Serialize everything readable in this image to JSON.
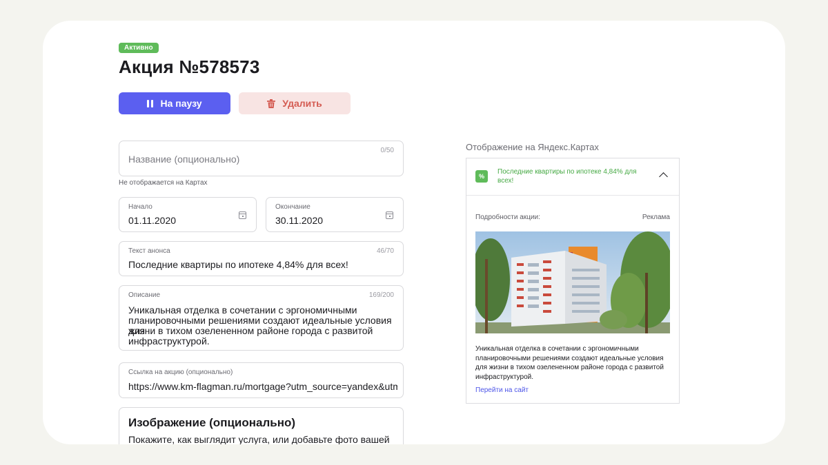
{
  "header": {
    "status_badge": "Активно",
    "title": "Акция №578573"
  },
  "actions": {
    "pause_label": "На паузу",
    "delete_label": "Удалить"
  },
  "form": {
    "name": {
      "placeholder": "Название (опционально)",
      "counter": "0/50",
      "hint": "Не отображается на Картах"
    },
    "start": {
      "label": "Начало",
      "value": "01.11.2020"
    },
    "end": {
      "label": "Окончание",
      "value": "30.11.2020"
    },
    "announce": {
      "label": "Текст анонса",
      "counter": "46/70",
      "value": "Последние квартиры по ипотеке 4,84% для всех!"
    },
    "description": {
      "label": "Описание",
      "counter": "169/200",
      "lines": [
        "Уникальная отделка в сочетании с эргономичными",
        "планировочными решениями создают идеальные условия для",
        "жизни в тихом озелененном районе города с развитой",
        "инфраструктурой."
      ]
    },
    "link": {
      "label": "Ссылка на акцию (опционально)",
      "value": "https://www.km-flagman.ru/mortgage?utm_source=yandex&utm_"
    },
    "image": {
      "title": "Изображение (опционально)",
      "description": "Покажите, как выглядит услуга, или добавьте фото вашей"
    }
  },
  "preview": {
    "heading": "Отображение на Яндекс.Картах",
    "percent_icon": "percent-icon",
    "headline": "Последние квартиры по ипотеке 4,84% для всех!",
    "details_label": "Подробности акции:",
    "ad_label": "Реклама",
    "body_lines": [
      "Уникальная отделка в сочетании с эргономичными",
      "планировочными решениями создают идеальные условия",
      "для жизни в тихом озелененном районе города с развитой",
      "инфраструктурой."
    ],
    "link_label": "Перейти на сайт"
  },
  "colors": {
    "accent": "#5b5ff0",
    "success": "#5fbb5a",
    "danger": "#d45b52",
    "link": "#4c54e8"
  }
}
